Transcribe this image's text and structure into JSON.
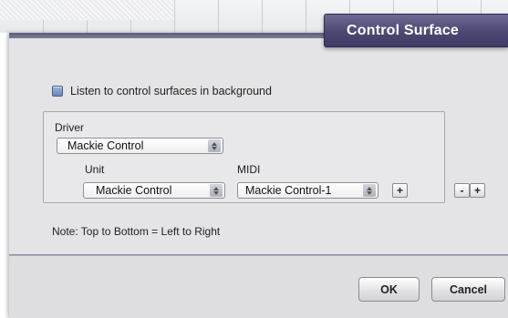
{
  "dialog": {
    "title": "Control Surface"
  },
  "background_checkbox": {
    "label": "Listen to control surfaces in background",
    "checked": false
  },
  "driver": {
    "label": "Driver",
    "value": "Mackie Control"
  },
  "unit": {
    "label": "Unit",
    "value": "Mackie Control"
  },
  "midi": {
    "label": "MIDI",
    "value": "Mackie Control-1"
  },
  "buttons": {
    "add_midi": "+",
    "remove_unit": "-",
    "add_unit": "+",
    "ok": "OK",
    "cancel": "Cancel"
  },
  "note": "Note: Top to Bottom = Left to Right",
  "colors": {
    "title_tab": "#4d4873",
    "checkbox": "#7a93c8"
  }
}
